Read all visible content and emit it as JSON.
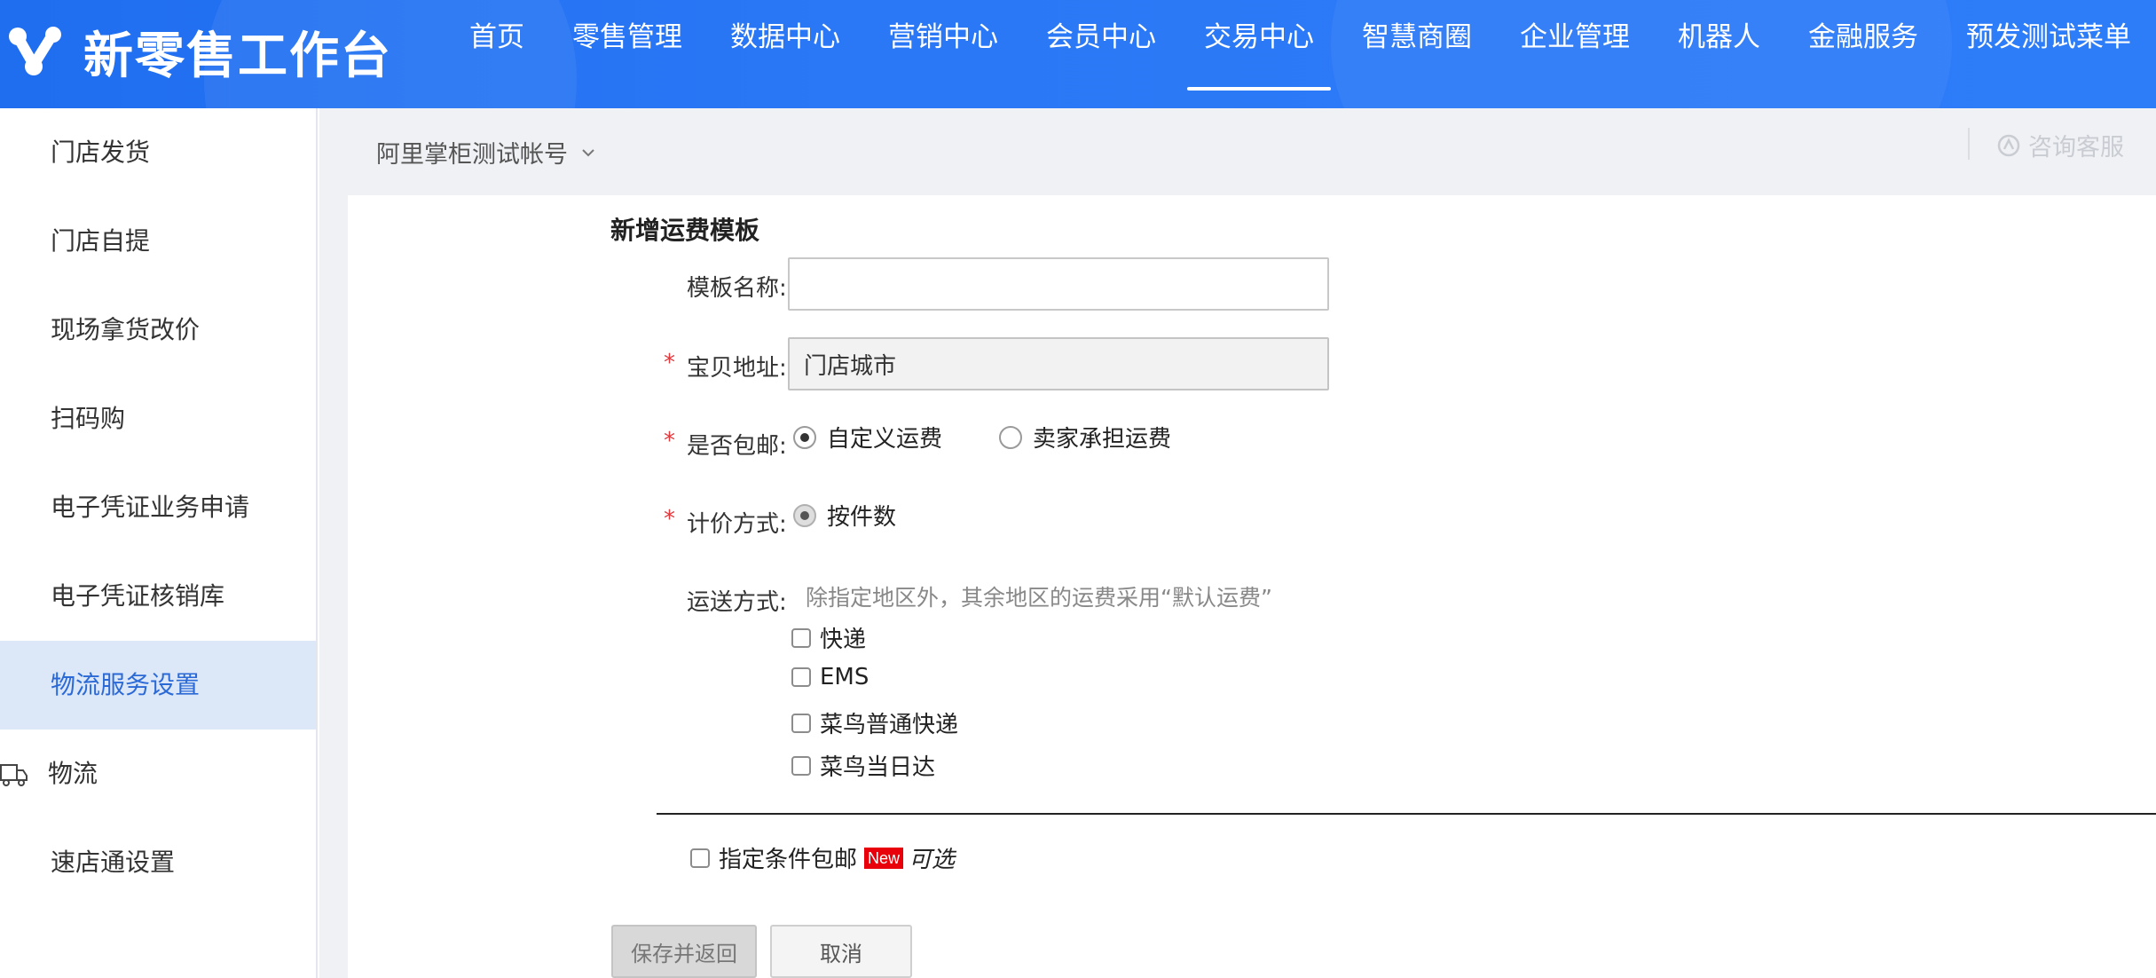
{
  "app": {
    "title": "新零售工作台"
  },
  "nav": {
    "items": [
      {
        "label": "首页",
        "active": false
      },
      {
        "label": "零售管理",
        "active": false
      },
      {
        "label": "数据中心",
        "active": false
      },
      {
        "label": "营销中心",
        "active": false
      },
      {
        "label": "会员中心",
        "active": false
      },
      {
        "label": "交易中心",
        "active": true
      },
      {
        "label": "智慧商圈",
        "active": false
      },
      {
        "label": "企业管理",
        "active": false
      },
      {
        "label": "机器人",
        "active": false
      },
      {
        "label": "金融服务",
        "active": false
      },
      {
        "label": "预发测试菜单",
        "active": false
      }
    ]
  },
  "sidebar": {
    "items": [
      {
        "label": "门店发货"
      },
      {
        "label": "门店自提"
      },
      {
        "label": "现场拿货改价"
      },
      {
        "label": "扫码购"
      },
      {
        "label": "电子凭证业务申请"
      },
      {
        "label": "电子凭证核销库"
      },
      {
        "label": "物流服务设置",
        "active": true
      },
      {
        "label": "物流",
        "icon": "truck-icon"
      },
      {
        "label": "速店通设置"
      }
    ]
  },
  "header": {
    "account": "阿里掌柜测试帐号",
    "service": "咨询客服"
  },
  "form": {
    "title": "新增运费模板",
    "template_name": {
      "label": "模板名称:",
      "value": "",
      "placeholder": ""
    },
    "address": {
      "label": "宝贝地址:",
      "value": "门店城市",
      "required": "*"
    },
    "free_shipping": {
      "label": "是否包邮:",
      "required": "*",
      "options": [
        {
          "label": "自定义运费",
          "selected": true
        },
        {
          "label": "卖家承担运费",
          "selected": false
        }
      ]
    },
    "pricing": {
      "label": "计价方式:",
      "required": "*",
      "option": {
        "label": "按件数",
        "selected": true
      }
    },
    "delivery": {
      "label": "运送方式:",
      "hint": "除指定地区外，其余地区的运费采用“默认运费”",
      "methods": [
        {
          "label": "快递",
          "checked": false
        },
        {
          "label": "EMS",
          "checked": false
        },
        {
          "label": "菜鸟普通快递",
          "checked": false
        },
        {
          "label": "菜鸟当日达",
          "checked": false
        }
      ]
    },
    "conditional_free": {
      "label": "指定条件包邮",
      "badge": "New",
      "optional": "可选",
      "checked": false
    },
    "buttons": {
      "save": "保存并返回",
      "cancel": "取消"
    }
  },
  "colors": {
    "topbar": "#2b78f6",
    "active_side_bg": "#dce7f8",
    "active_side_text": "#2b6ad6",
    "required": "#e4393c",
    "badge": "#e8000b"
  }
}
